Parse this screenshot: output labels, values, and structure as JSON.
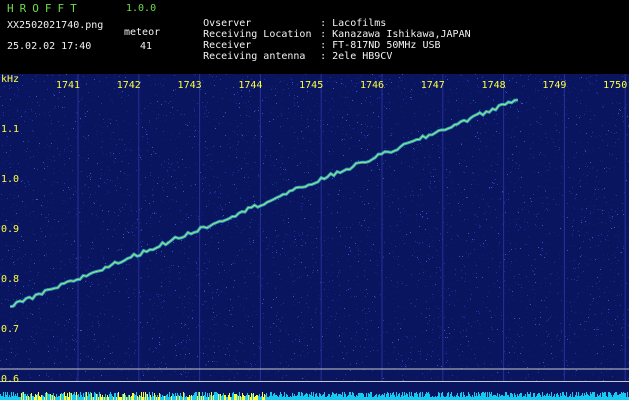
{
  "app": {
    "name": "HROFFT",
    "version": "1.0.0",
    "filename": "XX2502021740.png",
    "datetime": "25.02.02 17:40",
    "meteor_label": "meteor",
    "meteor_count": "41"
  },
  "station": {
    "rows": [
      {
        "label": "Ovserver",
        "value": ": Lacofilms"
      },
      {
        "label": "Receiving Location",
        "value": ": Kanazawa Ishikawa,JAPAN"
      },
      {
        "label": "Receiver",
        "value": ": FT-817ND 50MHz USB"
      },
      {
        "label": "Receiving antenna",
        "value": ": 2ele HB9CV"
      }
    ]
  },
  "chart_data": {
    "type": "spectrogram",
    "y_unit": "kHz",
    "x_ticks": [
      "1741",
      "1742",
      "1743",
      "1744",
      "1745",
      "1746",
      "1747",
      "1748",
      "1749",
      "1750"
    ],
    "y_ticks": [
      "1.1",
      "1.0",
      "0.9",
      "0.8",
      "0.7",
      "0.6"
    ],
    "ylim": [
      0.58,
      1.16
    ],
    "trace": {
      "x": [
        1740.05,
        1748.4
      ],
      "y": [
        0.745,
        1.16
      ]
    },
    "reference_lines_khz": [
      0.62,
      0.595
    ],
    "colors": {
      "background": "#0a1560",
      "noise": "#2233aa",
      "trace": "#33c8e6",
      "trace_hot": "#ccff44",
      "bottom_bar": "#17c8f0",
      "bottom_bar_hot": "#ffff33"
    }
  }
}
